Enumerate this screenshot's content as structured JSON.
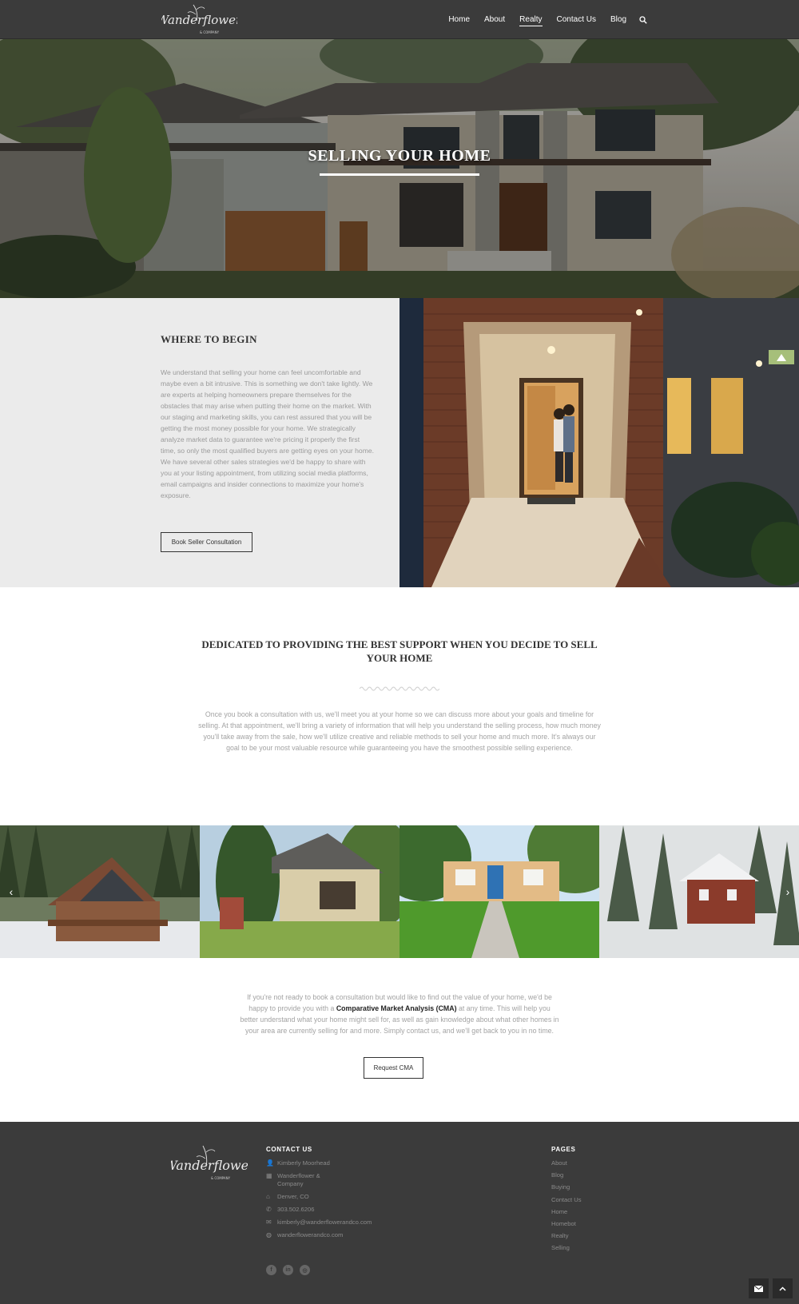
{
  "header": {
    "logo_text": "Wanderflower",
    "logo_sub": "& COMPANY",
    "nav": [
      {
        "label": "Home"
      },
      {
        "label": "About"
      },
      {
        "label": "Realty",
        "active": true
      },
      {
        "label": "Contact Us"
      },
      {
        "label": "Blog"
      }
    ],
    "search_icon": "search-icon"
  },
  "hero": {
    "title": "SELLING YOUR HOME"
  },
  "where_to_begin": {
    "heading": "WHERE TO BEGIN",
    "body": "We understand that selling your home can feel uncomfortable and maybe even a bit intrusive. This is something we don't take lightly. We are experts at helping homeowners prepare themselves for the obstacles that may arise when putting their home on the market. With our staging and marketing skills, you can rest assured that you will be getting the most money possible for your home. We strategically  analyze market data to guarantee we're pricing it properly the first time, so only the most qualified buyers are getting eyes on your home. We have several other sales strategies we'd be happy to share with you at your listing appointment, from utilizing social media platforms, email campaigns and insider connections to maximize your home's exposure.",
    "button": "Book Seller Consultation"
  },
  "dedicated": {
    "title": "DEDICATED TO PROVIDING THE BEST SUPPORT WHEN YOU DECIDE TO SELL YOUR HOME",
    "body": "Once you book a consultation with us, we'll meet you at your home so we can discuss more about your goals and timeline for selling. At that appointment, we'll bring a variety of information that will help you understand the selling process, how much money you'll take away from the sale, how we'll utilize creative and reliable methods to sell your home and much more. It's always our goal to be your most valuable resource while guaranteeing you have the smoothest possible selling experience."
  },
  "gallery": {
    "prev": "‹",
    "next": "›"
  },
  "cma": {
    "text_before": "If you're not ready to book a consultation but would like to find out the value of your home, we'd be happy to provide you with a ",
    "strong": "Comparative Market Analysis (CMA)",
    "text_after": " at any time. This will help you better understand what your home might sell for, as well as gain knowledge about what other homes in your area are currently selling for and more. Simply contact us, and we'll get back to you in no time.",
    "button": "Request CMA"
  },
  "footer": {
    "contact_heading": "CONTACT US",
    "contact": [
      {
        "icon": "user-icon",
        "glyph": "👤",
        "text": "Kimberly Moorhead"
      },
      {
        "icon": "building-icon",
        "glyph": "▦",
        "text": "Wanderflower & Company"
      },
      {
        "icon": "home-icon",
        "glyph": "⌂",
        "text": "Denver, CO"
      },
      {
        "icon": "phone-icon",
        "glyph": "✆",
        "text": "303.502.6206"
      },
      {
        "icon": "envelope-icon",
        "glyph": "✉",
        "text": "kimberly@wanderflowerandco.com"
      },
      {
        "icon": "globe-icon",
        "glyph": "◍",
        "text": "wanderflowerandco.com"
      }
    ],
    "pages_heading": "PAGES",
    "pages": [
      "About",
      "Blog",
      "Buying",
      "Contact Us",
      "Home",
      "Homebot",
      "Realty",
      "Selling"
    ],
    "social": [
      {
        "icon": "facebook-icon",
        "glyph": "f"
      },
      {
        "icon": "linkedin-icon",
        "glyph": "in"
      },
      {
        "icon": "instagram-icon",
        "glyph": "◎"
      }
    ]
  },
  "colors": {
    "header_bg": "#3b3b3b",
    "panel_bg": "#ebebeb",
    "accent_green": "#a6bf7a"
  }
}
